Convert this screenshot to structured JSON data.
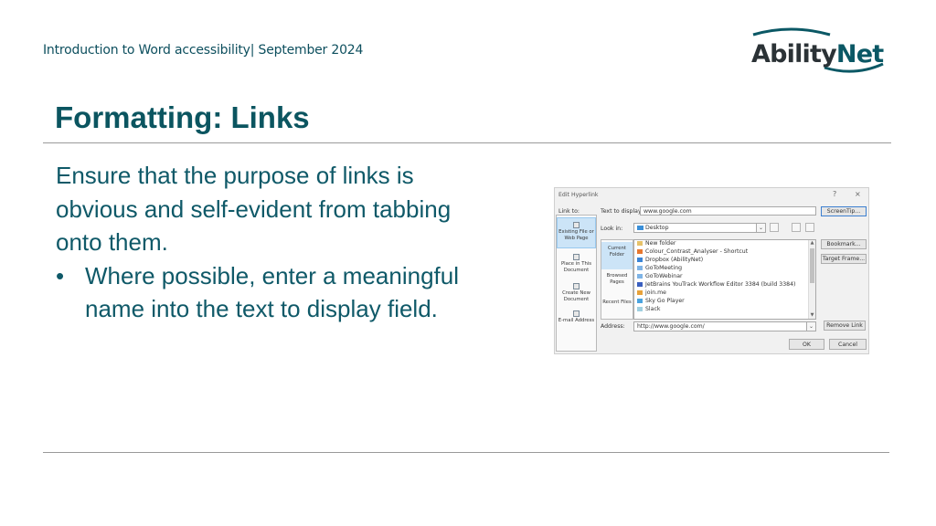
{
  "header": {
    "text": "Introduction to Word accessibility| September 2024"
  },
  "logo": {
    "text_a": "Ability",
    "text_b": "Net"
  },
  "slide": {
    "title": "Formatting: Links",
    "paragraph": "Ensure that the purpose of links is obvious and self-evident from tabbing onto them.",
    "bullet_char": "•",
    "bullet": "Where possible, enter a meaningful name into the text to display field."
  },
  "dialog": {
    "title": "Edit Hyperlink",
    "help": "?",
    "close": "×",
    "link_to_label": "Link to:",
    "text_to_display_label": "Text to display:",
    "text_to_display_value": "www.google.com",
    "screentip_button": "ScreenTip...",
    "look_in_label": "Look in:",
    "look_in_value": "Desktop",
    "link_types": [
      {
        "label": "Existing File or Web Page"
      },
      {
        "label": "Place in This Document"
      },
      {
        "label": "Create New Document"
      },
      {
        "label": "E-mail Address"
      }
    ],
    "nav_items": [
      {
        "label": "Current Folder"
      },
      {
        "label": "Browsed Pages"
      },
      {
        "label": "Recent Files"
      }
    ],
    "files": [
      {
        "name": "New folder"
      },
      {
        "name": "Colour_Contrast_Analyser - Shortcut"
      },
      {
        "name": "Dropbox (AbilityNet)"
      },
      {
        "name": "GoToMeeting"
      },
      {
        "name": "GoToWebinar"
      },
      {
        "name": "JetBrains YouTrack Workflow Editor 3384 (build 3384)"
      },
      {
        "name": "join.me"
      },
      {
        "name": "Sky Go Player"
      },
      {
        "name": "Slack"
      }
    ],
    "bookmark_button": "Bookmark...",
    "target_frame_button": "Target Frame...",
    "address_label": "Address:",
    "address_value": "http://www.google.com/",
    "remove_link_button": "Remove Link",
    "ok_button": "OK",
    "cancel_button": "Cancel"
  },
  "colors": {
    "teal": "#0b5560",
    "selection_blue": "#cce4f7"
  }
}
